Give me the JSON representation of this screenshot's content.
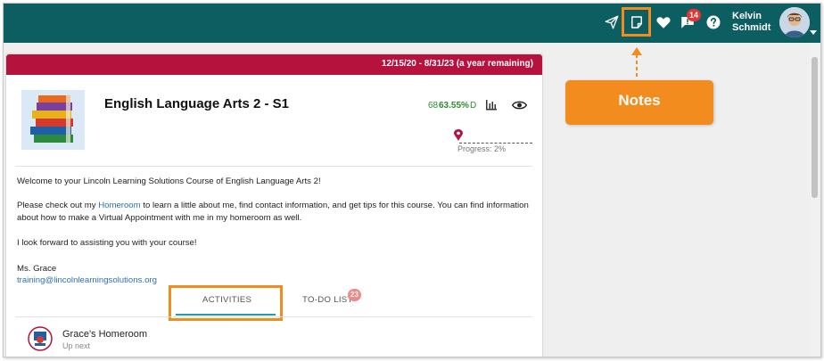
{
  "header": {
    "user_name": "Kelvin Schmidt",
    "messages_badge": "14",
    "icons": [
      "send-icon",
      "notes-icon",
      "heart-icon",
      "messages-icon",
      "help-icon"
    ]
  },
  "callout": {
    "label": "Notes"
  },
  "course": {
    "date_range": "12/15/20 - 8/31/23 (a year remaining)",
    "title": "English Language Arts 2 - S1",
    "grade_points": "68",
    "grade_percent": "63.55%",
    "grade_letter": "D",
    "progress_label": "Progress: 2%",
    "progress_value": 0.02
  },
  "welcome": {
    "line1": "Welcome to your Lincoln Learning Solutions Course of English Language Arts 2!",
    "p2_before": "Please check out my ",
    "p2_link": "Homeroom",
    "p2_after": " to learn a little about me, find contact information, and get tips for this course. You can find information about how to make a Virtual Appointment with me in my homeroom as well.",
    "line3": "I look forward to assisting you with your course!",
    "signature": "Ms. Grace",
    "email": "training@lincolnlearningsolutions.org"
  },
  "tabs": {
    "activities": "ACTIVITIES",
    "todo": "TO-DO LIST",
    "todo_badge": "23"
  },
  "activity": {
    "title": "Grace's Homeroom",
    "subtitle": "Up next"
  },
  "colors": {
    "topbar": "#0d5e60",
    "date_band": "#b5123e",
    "accent_orange": "#f28c1e",
    "grade_green": "#2e8b2e",
    "link_blue": "#2f6fb4",
    "tab_underline": "#1e9bb0"
  }
}
